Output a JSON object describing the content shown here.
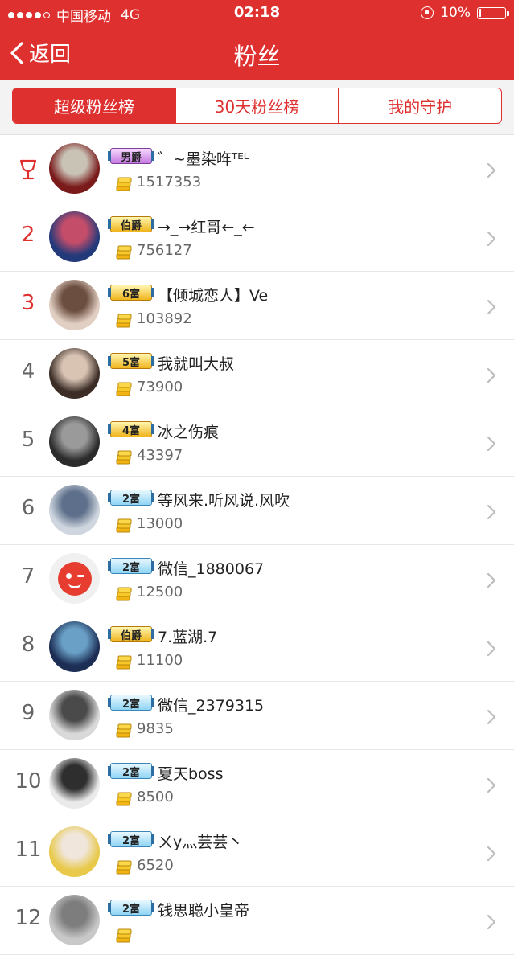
{
  "status_bar": {
    "carrier": "中国移动",
    "network": "4G",
    "time": "02:18",
    "battery": "10%",
    "battery_level": 0.1
  },
  "nav": {
    "back_label": "返回",
    "title": "粉丝"
  },
  "tabs": [
    {
      "label": "超级粉丝榜",
      "active": true
    },
    {
      "label": "30天粉丝榜",
      "active": false
    },
    {
      "label": "我的守护",
      "active": false
    }
  ],
  "colors": {
    "brand_red": "#df3030",
    "rank_top": "#df3030",
    "rank_normal": "#666666"
  },
  "fans": [
    {
      "rank": "",
      "rank_icon": "trophy-icon",
      "badge": "男爵",
      "badge_style": "purple",
      "name": "゛~墨染哖ᵀᴱᴸ",
      "score": "1517353"
    },
    {
      "rank": "2",
      "badge": "伯爵",
      "badge_style": "gold",
      "name": "→_→红哥←_←",
      "score": "756127"
    },
    {
      "rank": "3",
      "badge": "6富",
      "badge_style": "gold",
      "name": "【倾城恋人】Ve",
      "score": "103892"
    },
    {
      "rank": "4",
      "badge": "5富",
      "badge_style": "gold",
      "name": "我就叫大叔",
      "score": "73900"
    },
    {
      "rank": "5",
      "badge": "4富",
      "badge_style": "gold",
      "name": "冰之伤痕",
      "score": "43397"
    },
    {
      "rank": "6",
      "badge": "2富",
      "badge_style": "blue",
      "name": "等风来.听风说.风吹",
      "score": "13000"
    },
    {
      "rank": "7",
      "badge": "2富",
      "badge_style": "blue",
      "name": "微信_1880067",
      "score": "12500"
    },
    {
      "rank": "8",
      "badge": "伯爵",
      "badge_style": "gold",
      "name": "7.蓝湖.7",
      "score": "11100"
    },
    {
      "rank": "9",
      "badge": "2富",
      "badge_style": "blue",
      "name": "微信_2379315",
      "score": "9835"
    },
    {
      "rank": "10",
      "badge": "2富",
      "badge_style": "blue",
      "name": "夏天boss",
      "score": "8500"
    },
    {
      "rank": "11",
      "badge": "2富",
      "badge_style": "blue",
      "name": "ㄨy灬芸芸丶",
      "score": "6520"
    },
    {
      "rank": "12",
      "badge": "2富",
      "badge_style": "blue",
      "name": "钱思聪小皇帝",
      "score": ""
    }
  ]
}
